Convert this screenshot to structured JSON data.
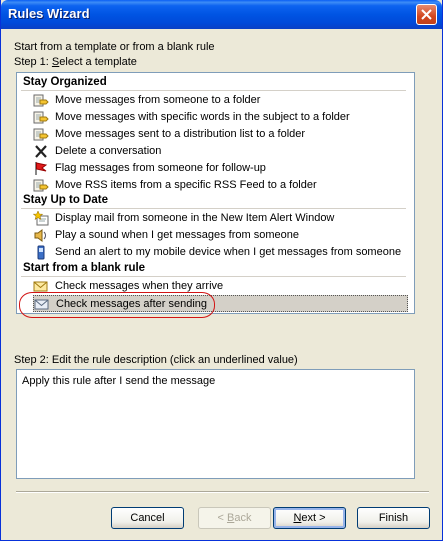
{
  "window": {
    "title": "Rules Wizard"
  },
  "intro": "Start from a template or from a blank rule",
  "step1": {
    "prefix": "Step 1: ",
    "accel": "S",
    "rest": "elect a template"
  },
  "groups": [
    {
      "header": "Stay Organized",
      "items": [
        {
          "label": "Move messages from someone to a folder",
          "icon": "folder-move-icon"
        },
        {
          "label": "Move messages with specific words in the subject to a folder",
          "icon": "folder-move-icon"
        },
        {
          "label": "Move messages sent to a distribution list to a folder",
          "icon": "folder-move-icon"
        },
        {
          "label": "Delete a conversation",
          "icon": "delete-x-icon"
        },
        {
          "label": "Flag messages from someone for follow-up",
          "icon": "red-flag-icon"
        },
        {
          "label": "Move RSS items from a specific RSS Feed to a folder",
          "icon": "folder-move-icon"
        }
      ]
    },
    {
      "header": "Stay Up to Date",
      "items": [
        {
          "label": "Display mail from someone in the New Item Alert Window",
          "icon": "alert-window-icon"
        },
        {
          "label": "Play a sound when I get messages from someone",
          "icon": "sound-icon"
        },
        {
          "label": "Send an alert to my mobile device when I get messages from someone",
          "icon": "mobile-device-icon"
        }
      ]
    },
    {
      "header": "Start from a blank rule",
      "items": [
        {
          "label": "Check messages when they arrive",
          "icon": "envelope-icon"
        },
        {
          "label": "Check messages after sending",
          "icon": "sent-envelope-icon",
          "selected": true
        }
      ]
    }
  ],
  "step2": {
    "label": "Step 2: Edit the rule description (click an underlined value)"
  },
  "description": "Apply this rule after I send the message",
  "buttons": {
    "cancel": "Cancel",
    "back_accel": "< ",
    "back_u": "B",
    "back_rest": "ack",
    "next_u": "N",
    "next_rest": "ext >",
    "finish": "Finish"
  },
  "colors": {
    "accent": "#0054e3",
    "selection": "#d4d0c8",
    "highlight_ring": "#d21414"
  }
}
